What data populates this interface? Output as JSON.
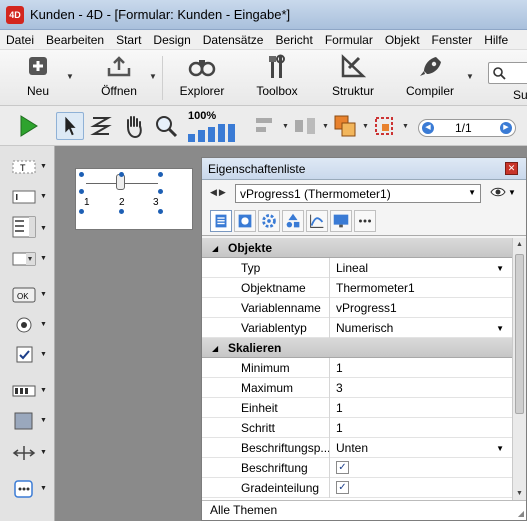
{
  "window": {
    "title": "Kunden - 4D - [Formular: Kunden -  Eingabe*]",
    "app_icon_text": "4D"
  },
  "menubar": {
    "items": [
      "Datei",
      "Bearbeiten",
      "Start",
      "Design",
      "Datensätze",
      "Bericht",
      "Formular",
      "Objekt",
      "Fenster",
      "Hilfe"
    ]
  },
  "toolbar": {
    "new_label": "Neu",
    "open_label": "Öffnen",
    "explorer_label": "Explorer",
    "toolbox_label": "Toolbox",
    "structure_label": "Struktur",
    "compiler_label": "Compiler",
    "search_label": "Su"
  },
  "tools2": {
    "zoom_percent": "100%",
    "page_indicator": "1/1"
  },
  "form_preview": {
    "ticks": [
      "1",
      "2",
      "3"
    ]
  },
  "property_list": {
    "title": "Eigenschaftenliste",
    "close_glyph": "✕",
    "object_selector": "vProgress1 (Thermometer1)",
    "sections": [
      {
        "label": "Objekte",
        "rows": [
          {
            "key": "Typ",
            "value": "Lineal",
            "dropdown": true
          },
          {
            "key": "Objektname",
            "value": "Thermometer1"
          },
          {
            "key": "Variablenname",
            "value": "vProgress1"
          },
          {
            "key": "Variablentyp",
            "value": "Numerisch",
            "dropdown": true
          }
        ]
      },
      {
        "label": "Skalieren",
        "rows": [
          {
            "key": "Minimum",
            "value": "1"
          },
          {
            "key": "Maximum",
            "value": "3"
          },
          {
            "key": "Einheit",
            "value": "1"
          },
          {
            "key": "Schritt",
            "value": "1"
          },
          {
            "key": "Beschriftungsp...",
            "value": "Unten",
            "dropdown": true
          },
          {
            "key": "Beschriftung",
            "checked": true
          },
          {
            "key": "Gradeinteilung",
            "checked": true
          }
        ]
      }
    ],
    "footer": "Alle Themen"
  },
  "colors": {
    "accent": "#3a7bd5",
    "title_bar": "#b9cde6",
    "section_header": "#cfcfcf",
    "close": "#c8342a"
  }
}
